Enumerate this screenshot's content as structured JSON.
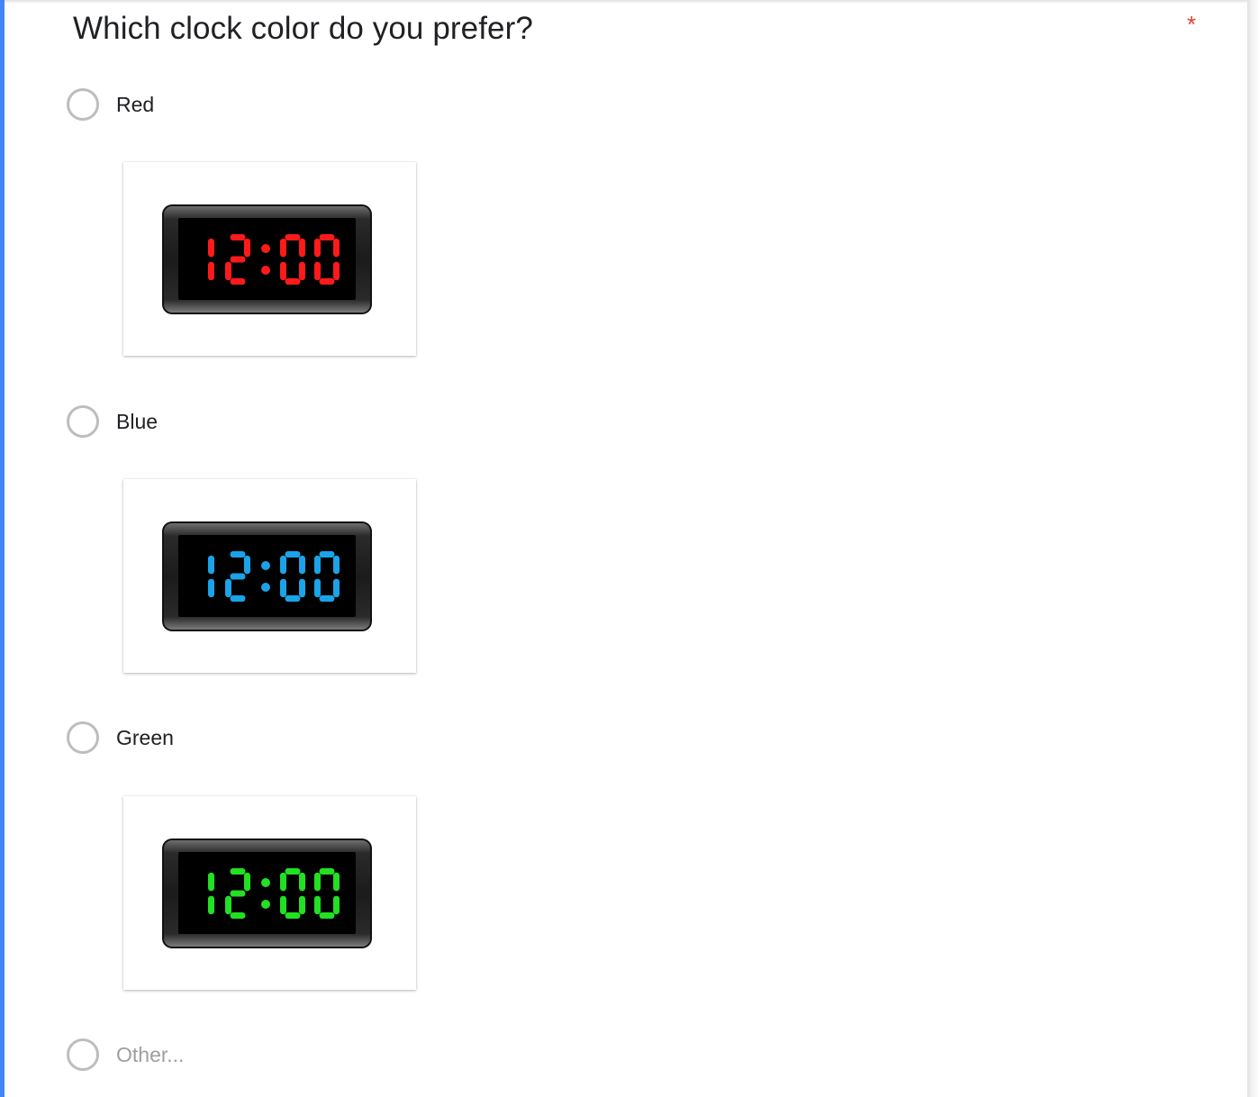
{
  "question": {
    "title": "Which clock color do you prefer?",
    "required_marker": "*"
  },
  "options": [
    {
      "label": "Red",
      "clock_time": "12:00",
      "digit_color": "#ff1a1a"
    },
    {
      "label": "Blue",
      "clock_time": "12:00",
      "digit_color": "#1aa3e8"
    },
    {
      "label": "Green",
      "clock_time": "12:00",
      "digit_color": "#22e022"
    }
  ],
  "other_option": {
    "label": "Other..."
  },
  "colors": {
    "accent": "#4285f4",
    "required": "#db4437",
    "radio_border": "#bdbdbd"
  }
}
